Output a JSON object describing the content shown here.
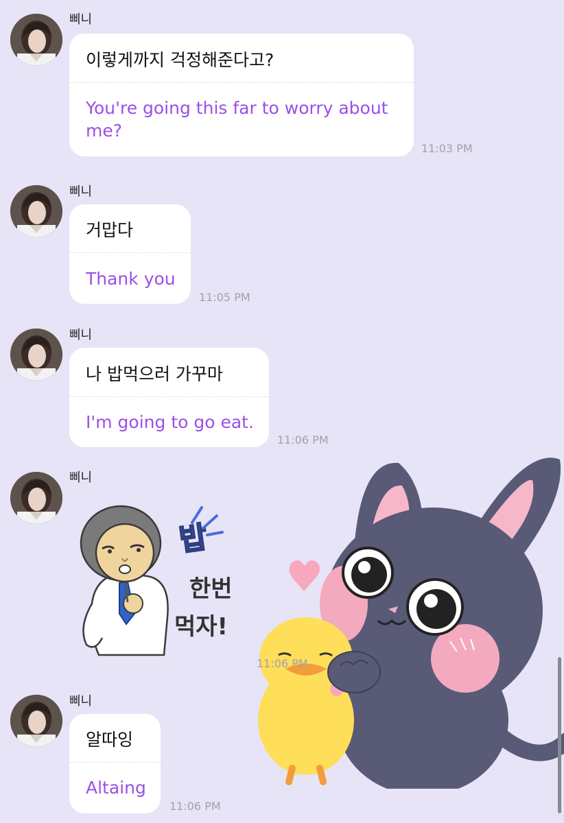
{
  "messages": [
    {
      "sender": "삐니",
      "original": "이렇게까지 걱정해준다고?",
      "translation": "You're going this far to worry about me?",
      "time": "11:03 PM"
    },
    {
      "sender": "삐니",
      "original": "거맙다",
      "translation": "Thank you",
      "time": "11:05 PM"
    },
    {
      "sender": "삐니",
      "original": "나 밥먹으러 가꾸마",
      "translation": "I'm going to go eat.",
      "time": "11:06 PM"
    },
    {
      "sender": "삐니",
      "sticker_text": [
        "밥",
        "한번",
        "먹자!"
      ],
      "time": "11:06 PM"
    },
    {
      "sender": "삐니",
      "original": "알따잉",
      "translation": "Altaing",
      "time": "11:06 PM"
    }
  ],
  "colors": {
    "background": "#e7e4f7",
    "translation": "#9b4fe6",
    "timestamp": "#a3a0ad"
  },
  "icons": {
    "avatar": "profile-photo",
    "man_sticker": "man-eating-sticker",
    "cat_sticker": "bunny-cat-with-duckling-sticker"
  }
}
